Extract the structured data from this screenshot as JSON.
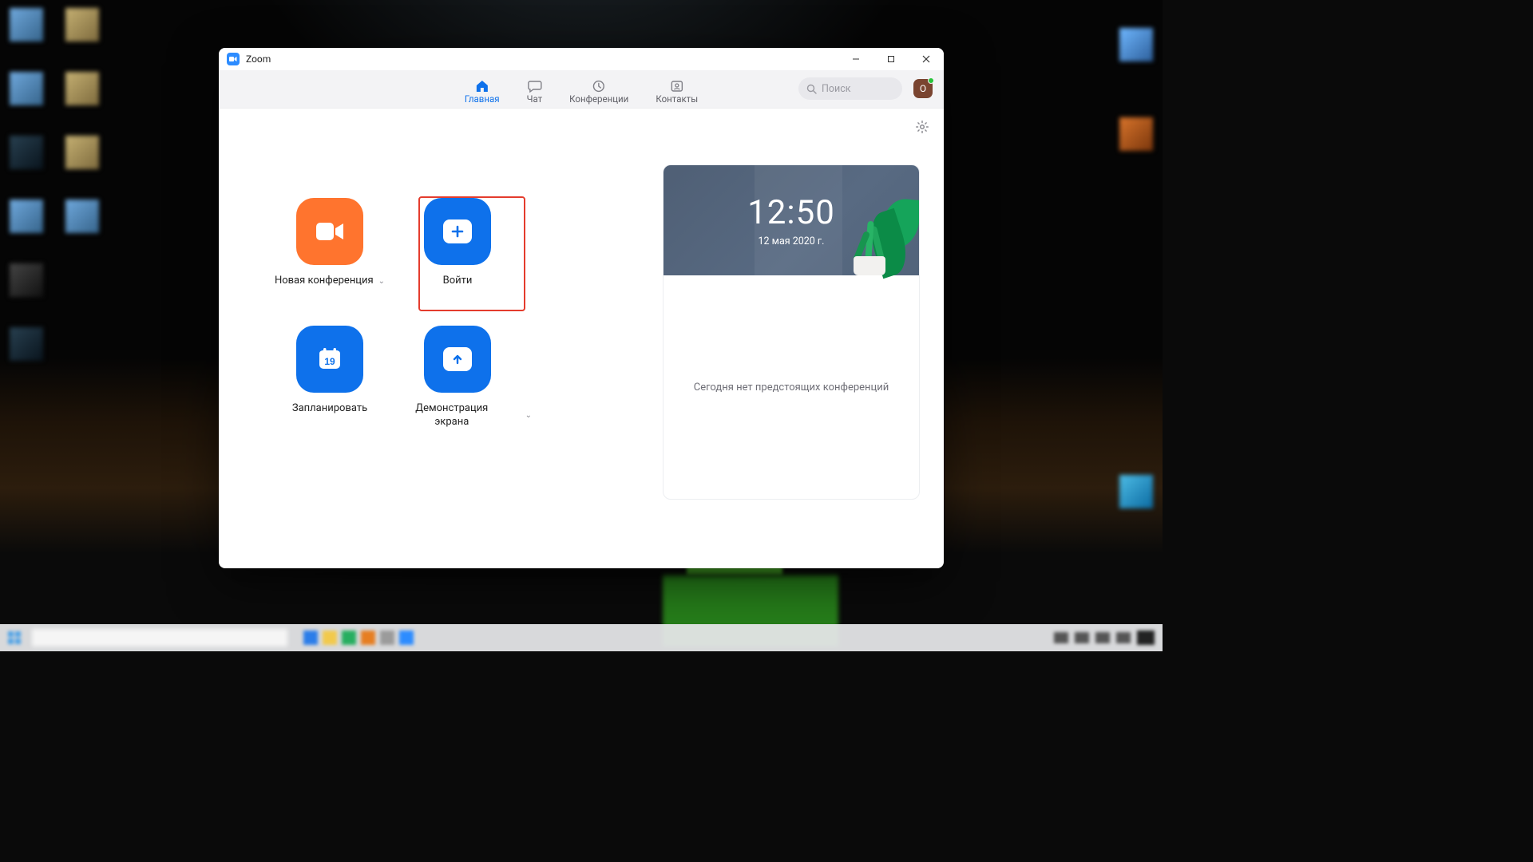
{
  "window": {
    "title": "Zoom"
  },
  "tabs": {
    "home": "Главная",
    "chat": "Чат",
    "meetings": "Конференции",
    "contacts": "Контакты"
  },
  "search": {
    "placeholder": "Поиск"
  },
  "avatar": {
    "initial": "О"
  },
  "actions": {
    "new_meeting": "Новая конференция",
    "join": "Войти",
    "schedule": "Запланировать",
    "share_screen": "Демонстрация экрана"
  },
  "calendar_tile_day": "19",
  "clock": {
    "time": "12:50",
    "date": "12 мая 2020 г."
  },
  "no_meetings": "Сегодня нет предстоящих конференций"
}
